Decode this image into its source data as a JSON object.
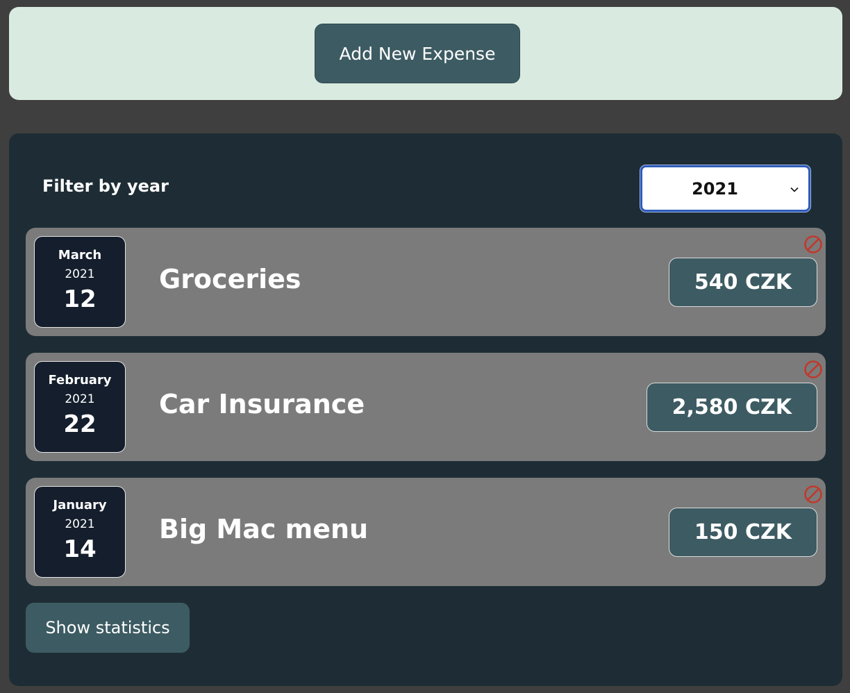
{
  "new_expense": {
    "add_label": "Add New Expense"
  },
  "filter": {
    "label": "Filter by year",
    "selected_year": "2021"
  },
  "expenses": [
    {
      "month": "March",
      "year": "2021",
      "day": "12",
      "title": "Groceries",
      "amount": "540 CZK"
    },
    {
      "month": "February",
      "year": "2021",
      "day": "22",
      "title": "Car Insurance",
      "amount": "2,580 CZK"
    },
    {
      "month": "January",
      "year": "2021",
      "day": "14",
      "title": "Big Mac menu",
      "amount": "150 CZK"
    }
  ],
  "stats": {
    "label": "Show statistics"
  },
  "icons": {
    "delete": "prohibited-icon",
    "dropdown": "chevron-down-icon"
  },
  "colors": {
    "page_bg": "#3f3f3f",
    "panel_light": "#d9ebe0",
    "panel_dark": "#1e2d35",
    "button": "#3d5b62",
    "item_bg": "#7b7b7b",
    "date_bg": "#141e2c",
    "delete_red": "#c0392b",
    "select_focus": "#2e5bb8"
  }
}
